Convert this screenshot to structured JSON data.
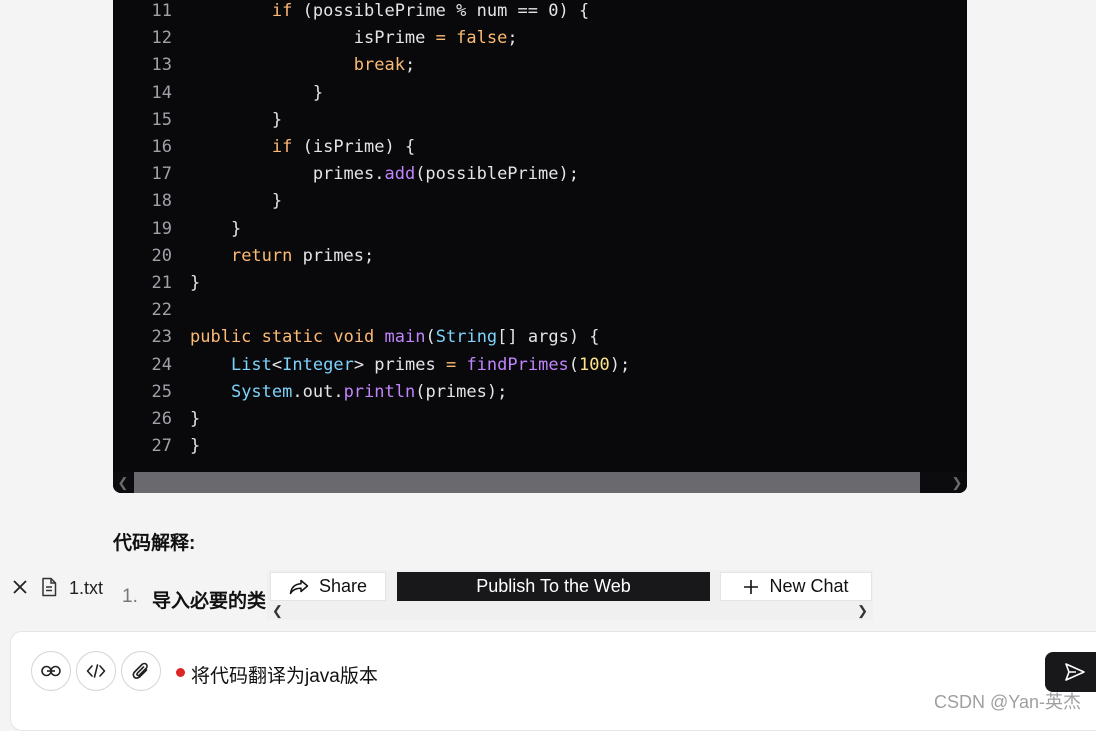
{
  "code": {
    "lines": [
      {
        "n": "11",
        "t": [
          {
            "s": "        "
          },
          {
            "s": "if",
            "c": "kw"
          },
          {
            "s": " (possiblePrime % num == 0) {"
          }
        ]
      },
      {
        "n": "12",
        "t": [
          {
            "s": "                isPrime "
          },
          {
            "s": "=",
            "c": "kw"
          },
          {
            "s": " "
          },
          {
            "s": "false",
            "c": "kw"
          },
          {
            "s": ";"
          }
        ]
      },
      {
        "n": "13",
        "t": [
          {
            "s": "                "
          },
          {
            "s": "break",
            "c": "kw"
          },
          {
            "s": ";"
          }
        ]
      },
      {
        "n": "14",
        "t": [
          {
            "s": "            }"
          }
        ]
      },
      {
        "n": "15",
        "t": [
          {
            "s": "        }"
          }
        ]
      },
      {
        "n": "16",
        "t": [
          {
            "s": "        "
          },
          {
            "s": "if",
            "c": "kw"
          },
          {
            "s": " (isPrime) {"
          }
        ]
      },
      {
        "n": "17",
        "t": [
          {
            "s": "            primes."
          },
          {
            "s": "add",
            "c": "fn"
          },
          {
            "s": "(possiblePrime);"
          }
        ]
      },
      {
        "n": "18",
        "t": [
          {
            "s": "        }"
          }
        ]
      },
      {
        "n": "19",
        "t": [
          {
            "s": "    }"
          }
        ]
      },
      {
        "n": "20",
        "t": [
          {
            "s": "    "
          },
          {
            "s": "return",
            "c": "kw"
          },
          {
            "s": " primes;"
          }
        ]
      },
      {
        "n": "21",
        "t": [
          {
            "s": "}"
          }
        ]
      },
      {
        "n": "22",
        "t": []
      },
      {
        "n": "23",
        "t": [
          {
            "s": "public",
            "c": "kw"
          },
          {
            "s": " "
          },
          {
            "s": "static",
            "c": "kw"
          },
          {
            "s": " "
          },
          {
            "s": "void",
            "c": "kw"
          },
          {
            "s": " "
          },
          {
            "s": "main",
            "c": "fn"
          },
          {
            "s": "("
          },
          {
            "s": "String",
            "c": "ty"
          },
          {
            "s": "[] args) {"
          }
        ]
      },
      {
        "n": "24",
        "t": [
          {
            "s": "    "
          },
          {
            "s": "List",
            "c": "ty"
          },
          {
            "s": "<"
          },
          {
            "s": "Integer",
            "c": "ty"
          },
          {
            "s": "> primes "
          },
          {
            "s": "=",
            "c": "kw"
          },
          {
            "s": " "
          },
          {
            "s": "findPrimes",
            "c": "fn"
          },
          {
            "s": "("
          },
          {
            "s": "100",
            "c": "num"
          },
          {
            "s": ");"
          }
        ]
      },
      {
        "n": "25",
        "t": [
          {
            "s": "    "
          },
          {
            "s": "System",
            "c": "ty"
          },
          {
            "s": ".out."
          },
          {
            "s": "println",
            "c": "fn"
          },
          {
            "s": "(primes);"
          }
        ]
      },
      {
        "n": "26",
        "t": [
          {
            "s": "}"
          }
        ]
      },
      {
        "n": "27",
        "t": [
          {
            "s": "}"
          }
        ]
      }
    ]
  },
  "explanation": {
    "heading": "代码解释:",
    "item_number": "1.",
    "item_text": "导入必要的类"
  },
  "attachment": {
    "file_name": "1.txt"
  },
  "toolbar": {
    "share_label": "Share",
    "publish_label": "Publish To the Web",
    "new_chat_label": "New Chat"
  },
  "input": {
    "prompt_text": "将代码翻译为java版本"
  },
  "watermark": "CSDN @Yan-英杰"
}
